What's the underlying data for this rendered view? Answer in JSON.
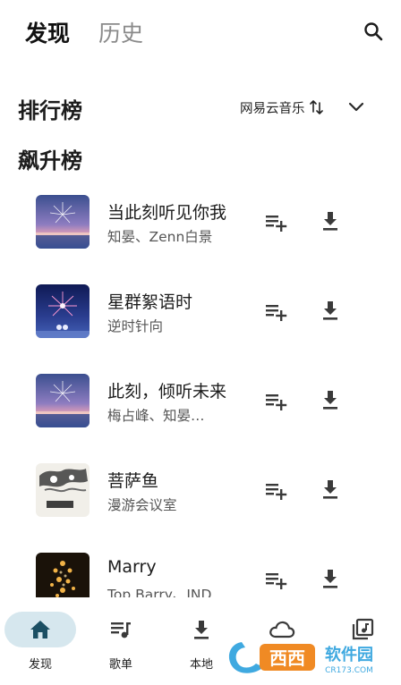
{
  "top_tabs": {
    "discover": "发现",
    "history": "历史"
  },
  "icons": {
    "search": "search-icon",
    "sort": "swap-vert-icon",
    "chevron": "chevron-down-icon",
    "add_to_queue": "playlist-add-icon",
    "download": "download-icon"
  },
  "ranking": {
    "title": "排行榜",
    "source": "网易云音乐"
  },
  "chart": {
    "name": "飙升榜"
  },
  "songs": [
    {
      "title": "当此刻听见你我",
      "artist": "知晏、Zenn白景",
      "cover": "fireworks-sunset"
    },
    {
      "title": "星群絮语时",
      "artist": "逆时针向",
      "cover": "fireworks-night"
    },
    {
      "title": "此刻，倾听未来",
      "artist": "梅占峰、知晏…",
      "cover": "fireworks-sunset"
    },
    {
      "title": "菩萨鱼",
      "artist": "漫游会议室",
      "cover": "ink-painting"
    },
    {
      "title": "Marry",
      "artist": "Top Barry、IND…",
      "cover": "golden-lights"
    }
  ],
  "bottom_nav": [
    {
      "label": "发现",
      "icon": "home-icon",
      "active": true
    },
    {
      "label": "歌单",
      "icon": "queue-music-icon",
      "active": false
    },
    {
      "label": "本地",
      "icon": "download-icon",
      "active": false
    },
    {
      "label": "",
      "icon": "cloud-icon",
      "active": false
    },
    {
      "label": "",
      "icon": "library-music-icon",
      "active": false
    }
  ],
  "colors": {
    "active_pill": "#d6e7ee",
    "active_icon": "#1b4f63",
    "icon": "#3a3a3a"
  },
  "watermark": {
    "brand": "西西",
    "tagline": "软件园",
    "site": "CR173.COM"
  }
}
